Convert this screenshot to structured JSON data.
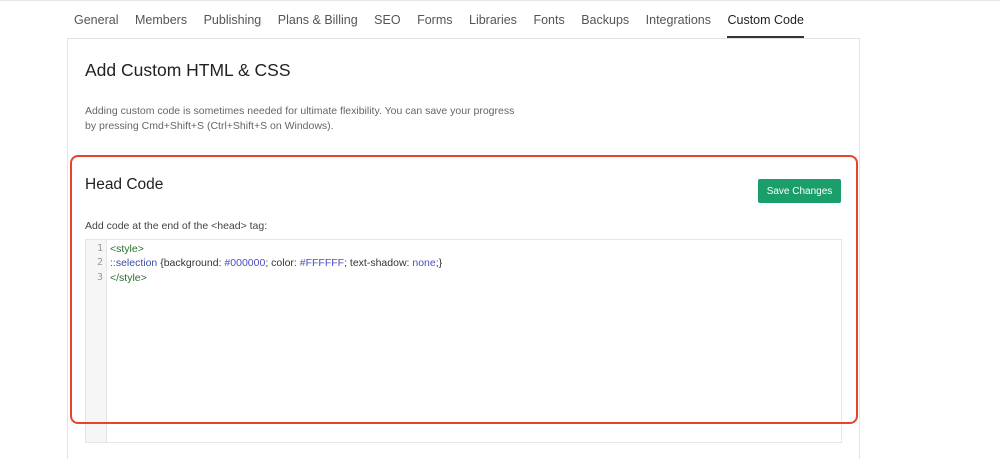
{
  "tabs": [
    {
      "label": "General"
    },
    {
      "label": "Members"
    },
    {
      "label": "Publishing"
    },
    {
      "label": "Plans & Billing"
    },
    {
      "label": "SEO"
    },
    {
      "label": "Forms"
    },
    {
      "label": "Libraries"
    },
    {
      "label": "Fonts"
    },
    {
      "label": "Backups"
    },
    {
      "label": "Integrations"
    },
    {
      "label": "Custom Code",
      "active": true
    }
  ],
  "panel": {
    "title": "Add Custom HTML & CSS",
    "description_line1": "Adding custom code is sometimes needed for ultimate flexibility. You can save your progress",
    "description_line2": "by pressing Cmd+Shift+S (Ctrl+Shift+S on Windows)."
  },
  "head_code": {
    "title": "Head Code",
    "save_label": "Save Changes",
    "field_label": "Add code at the end of the <head> tag:",
    "lines": [
      {
        "num": "1",
        "parts": [
          {
            "t": "<style>",
            "c": "tag"
          }
        ]
      },
      {
        "num": "2",
        "parts": [
          {
            "t": "::selection",
            "c": "sel"
          },
          {
            "t": " {background: ",
            "c": "txt"
          },
          {
            "t": "#000000",
            "c": "val"
          },
          {
            "t": "; color: ",
            "c": "txt"
          },
          {
            "t": "#FFFFFF",
            "c": "val"
          },
          {
            "t": "; text-shadow: ",
            "c": "txt"
          },
          {
            "t": "none",
            "c": "val"
          },
          {
            "t": ";}",
            "c": "txt"
          }
        ]
      },
      {
        "num": "3",
        "parts": [
          {
            "t": "</style>",
            "c": "tag"
          }
        ]
      }
    ]
  },
  "colors": {
    "accent_button": "#1a9e6a",
    "highlight_outline": "#e8442d"
  }
}
